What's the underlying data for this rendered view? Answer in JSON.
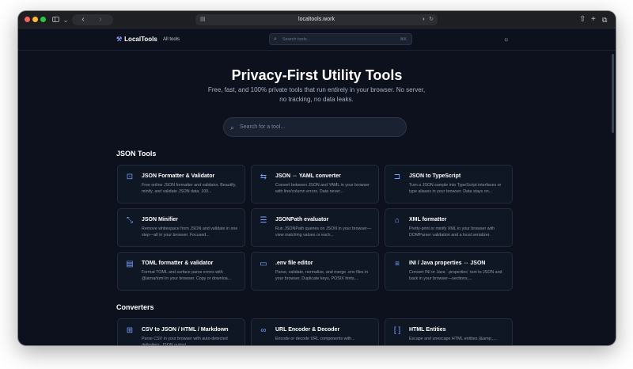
{
  "browser": {
    "url": "localtools.work",
    "nav_back": "‹",
    "nav_forward": "›"
  },
  "header": {
    "logo": "LocalTools",
    "all_tools": "All tools",
    "search_placeholder": "Search tools...",
    "search_shortcut": "⌘K"
  },
  "hero": {
    "title": "Privacy-First Utility Tools",
    "subtitle": "Free, fast, and 100% private tools that run entirely in your browser. No server, no tracking, no data leaks.",
    "search_placeholder": "Search for a tool..."
  },
  "sections": [
    {
      "title": "JSON Tools",
      "cards": [
        {
          "icon": "json-file-icon",
          "title": "JSON Formatter & Validator",
          "description": "Free online JSON formatter and validator. Beautify, minify, and validate JSON data. 100..."
        },
        {
          "icon": "swap-arrows-icon",
          "title": "JSON ⇔ YAML converter",
          "description": "Convert between JSON and YAML in your browser with line/column errors. Data never..."
        },
        {
          "icon": "code-file-icon",
          "title": "JSON to TypeScript",
          "description": "Turn a JSON sample into TypeScript interfaces or type aliases in your browser. Data stays on..."
        },
        {
          "icon": "minimize-icon",
          "title": "JSON Minifier",
          "description": "Remove whitespace from JSON and validate in one step—all in your browser. Focused..."
        },
        {
          "icon": "list-query-icon",
          "title": "JSONPath evaluator",
          "description": "Run JSONPath queries on JSON in your browser—view matching values or each..."
        },
        {
          "icon": "tag-icon",
          "title": "XML formatter",
          "description": "Pretty-print or minify XML in your browser with DOMParser validation and a local serializer."
        },
        {
          "icon": "document-icon",
          "title": "TOML formatter & validator",
          "description": "Format TOML and surface parse errors with @iarna/toml in your browser. Copy or downloa..."
        },
        {
          "icon": "folder-icon",
          "title": ".env file editor",
          "description": "Parse, validate, normalize, and merge .env files in your browser. Duplicate keys, POSIX hints,..."
        },
        {
          "icon": "settings-list-icon",
          "title": "INI / Java properties ⇔ JSON",
          "description": "Convert INI or Java `.properties` text to JSON and back in your browser—sections,..."
        }
      ]
    },
    {
      "title": "Converters",
      "cards": [
        {
          "icon": "table-icon",
          "title": "CSV to JSON / HTML / Markdown",
          "description": "Parse CSV in your browser with auto-detected delimiters, JSON output..."
        },
        {
          "icon": "link-icon",
          "title": "URL Encoder & Decoder",
          "description": "Encode or decode URL components with..."
        },
        {
          "icon": "brackets-icon",
          "title": "HTML Entities",
          "description": "Escape and unescape HTML entities (&amp;,..."
        }
      ]
    }
  ]
}
